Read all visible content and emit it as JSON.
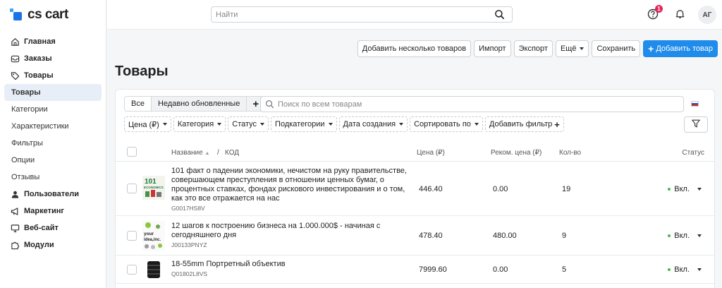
{
  "app": {
    "logo_text": "cs cart"
  },
  "header": {
    "search_placeholder": "Найти",
    "notification_count": "1",
    "avatar_initials": "АГ"
  },
  "sidebar": {
    "items": [
      {
        "label": "Главная",
        "icon": "home-icon"
      },
      {
        "label": "Заказы",
        "icon": "inbox-icon"
      },
      {
        "label": "Товары",
        "icon": "tag-icon"
      },
      {
        "label": "Товары"
      },
      {
        "label": "Категории"
      },
      {
        "label": "Характеристики"
      },
      {
        "label": "Фильтры"
      },
      {
        "label": "Опции"
      },
      {
        "label": "Отзывы"
      },
      {
        "label": "Пользователи",
        "icon": "users-icon"
      },
      {
        "label": "Маркетинг",
        "icon": "megaphone-icon"
      },
      {
        "label": "Веб-сайт",
        "icon": "monitor-icon"
      },
      {
        "label": "Модули",
        "icon": "puzzle-icon"
      }
    ]
  },
  "toolbar": {
    "add_multiple": "Добавить несколько товаров",
    "import": "Импорт",
    "export": "Экспорт",
    "more": "Ещё",
    "save": "Сохранить",
    "add_product": "Добавить товар"
  },
  "page": {
    "title": "Товары"
  },
  "tabs": {
    "all": "Все",
    "recent": "Недавно обновленные",
    "add": "+"
  },
  "product_search": {
    "placeholder": "Поиск по всем товарам"
  },
  "filters": {
    "price": "Цена (₽)",
    "category": "Категория",
    "status": "Статус",
    "subcategories": "Подкатегории",
    "created": "Дата создания",
    "sort": "Сортировать по",
    "add_filter": "Добавить фильтр"
  },
  "table": {
    "headers": {
      "name": "Название",
      "sep": "/",
      "code": "КОД",
      "price": "Цена (₽)",
      "rec_price": "Реком. цена (₽)",
      "qty": "Кол-во",
      "status": "Статус"
    },
    "rows": [
      {
        "name": "101 факт о падении экономики, нечистом на руку правительстве, совершающем преступления в отношении ценных бумаг, о процентных ставках, фондах рискового инвестирования и о том, как это все отражается на нас",
        "code": "G0017HS8V",
        "price": "446.40",
        "rec_price": "0.00",
        "qty": "19",
        "status": "Вкл.",
        "thumb_text": "101 ECONOMICS"
      },
      {
        "name": "12 шагов к построению бизнеса на 1.000.000$ - начиная с сегодняшнего дня",
        "code": "J00133PNYZ",
        "price": "478.40",
        "rec_price": "480.00",
        "qty": "9",
        "status": "Вкл.",
        "thumb_text": "your idea, inc."
      },
      {
        "name": "18-55mm Портретный объектив",
        "code": "Q01802L8VS",
        "price": "7999.60",
        "rec_price": "0.00",
        "qty": "5",
        "status": "Вкл."
      }
    ]
  },
  "colors": {
    "accent": "#1f8bea",
    "status_on": "#49b84a",
    "badge": "#e6245d"
  }
}
